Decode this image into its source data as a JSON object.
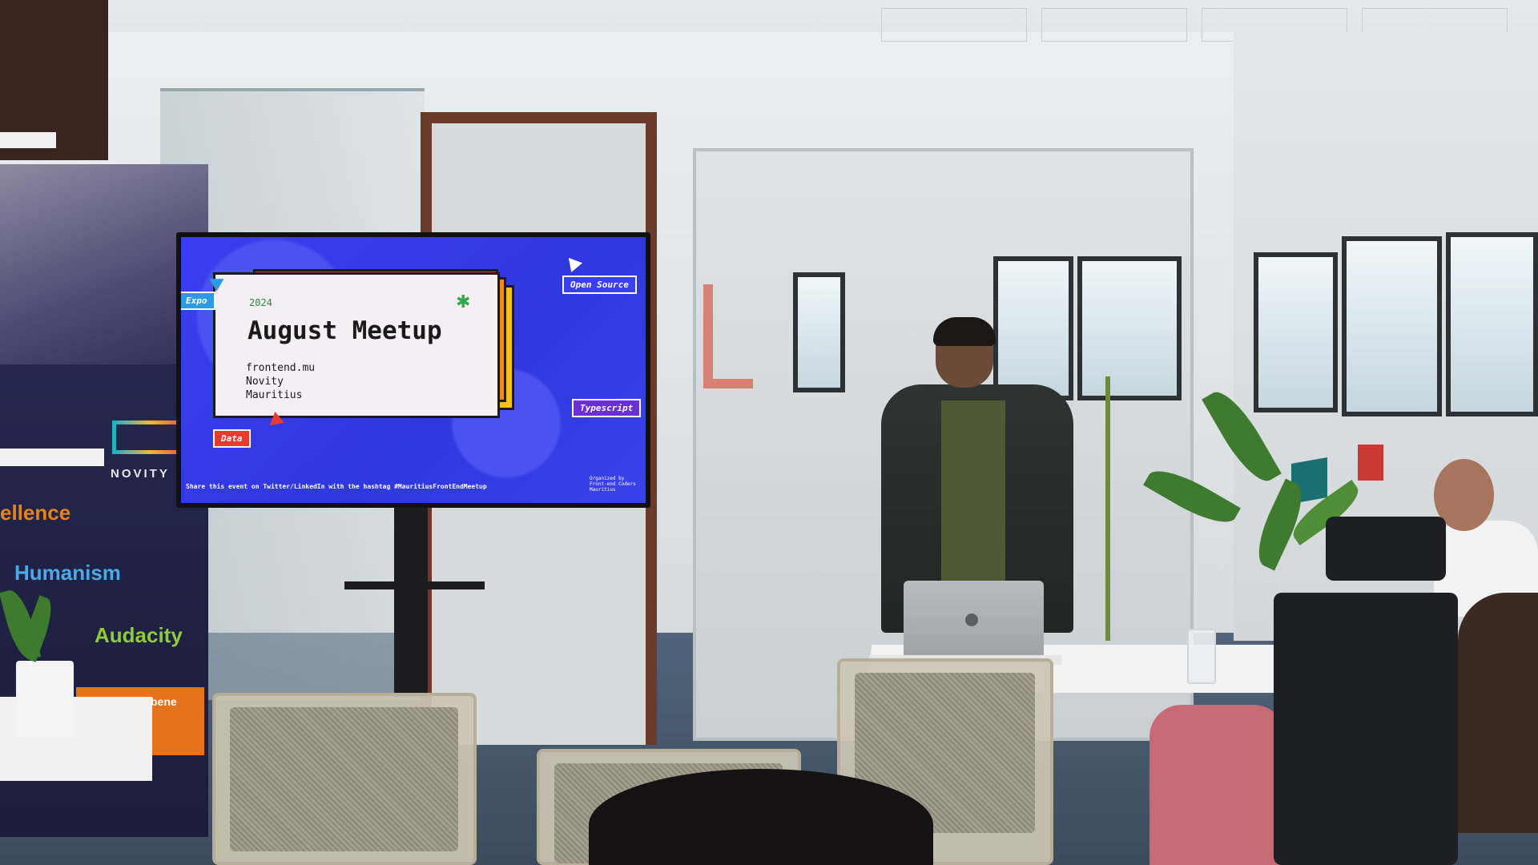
{
  "slide": {
    "year": "2024",
    "title": "August Meetup",
    "lines": [
      "frontend.mu",
      "Novity",
      "Mauritius"
    ],
    "tags": {
      "expo": "Expo",
      "open_source": "Open Source",
      "typescript": "Typescript",
      "data": "Data"
    },
    "footer": "Share this event on Twitter/LinkedIn with the hashtag #MauritiusFrontEndMeetup",
    "organizer": "Organized by Front-end Coders Mauritius"
  },
  "banner": {
    "brand": "NOVITY",
    "values": [
      "ellence",
      "Humanism",
      "Audacity"
    ],
    "address": "uilding, Ebene"
  },
  "colors": {
    "slide_blue": "#3a3ff0",
    "card_red": "#e93a2f",
    "card_orange": "#f08a1a",
    "card_yellow": "#f4c21b",
    "banner_navy": "#22254a"
  }
}
